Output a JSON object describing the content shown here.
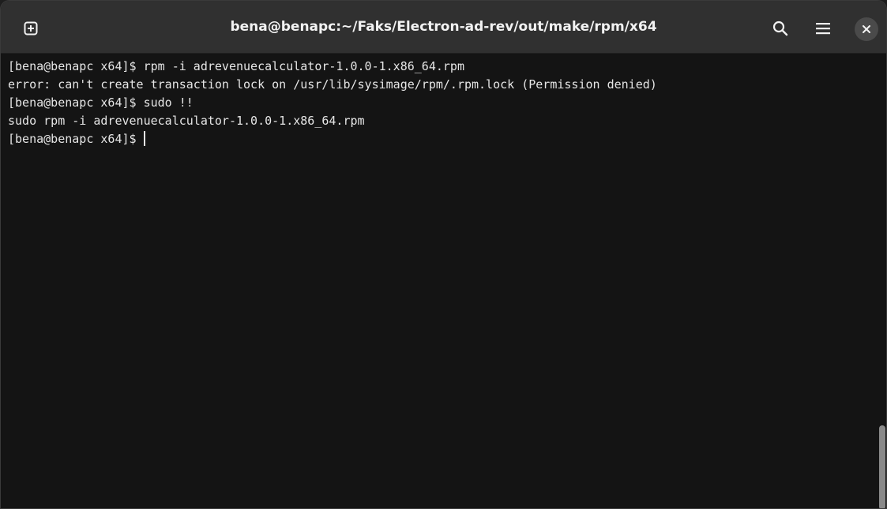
{
  "window": {
    "title": "bena@benapc:~/Faks/Electron-ad-rev/out/make/rpm/x64"
  },
  "titlebar": {
    "new_tab_icon": "new-tab-icon",
    "search_icon": "search-icon",
    "menu_icon": "hamburger-menu-icon",
    "close_icon": "close-icon"
  },
  "terminal": {
    "lines": [
      "[bena@benapc x64]$ rpm -i adrevenuecalculator-1.0.0-1.x86_64.rpm",
      "error: can't create transaction lock on /usr/lib/sysimage/rpm/.rpm.lock (Permission denied)",
      "[bena@benapc x64]$ sudo !!",
      "sudo rpm -i adrevenuecalculator-1.0.0-1.x86_64.rpm",
      "[bena@benapc x64]$"
    ]
  },
  "colors": {
    "titlebar_bg": "#303030",
    "terminal_bg": "#141414",
    "text": "#e6e6e6"
  }
}
